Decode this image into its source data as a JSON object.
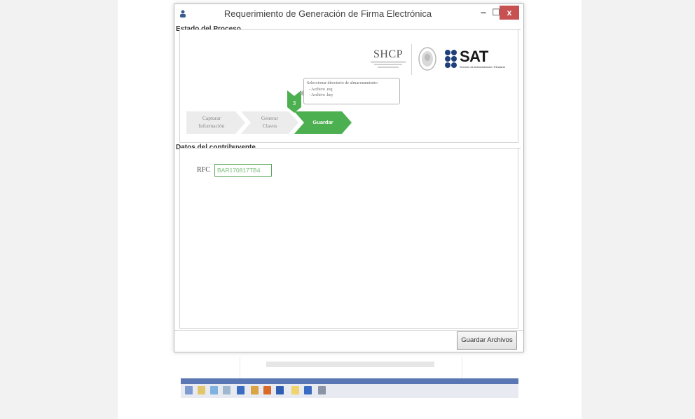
{
  "window": {
    "title": "Requerimiento de Generación de Firma Electrónica",
    "controls": {
      "minimize": "‒",
      "maximize": "☐",
      "close": "x"
    }
  },
  "estado": {
    "group_label": "Estado del Proceso",
    "logos": {
      "shcp": "SHCP",
      "sat": "SAT",
      "sat_subtitle": "Servicio de Administración Tributaria"
    },
    "callout": {
      "title": "Seleccionar directorio de almacenamiento",
      "items": [
        "- Archivo .req",
        "- Archivo .key"
      ]
    },
    "steps": [
      {
        "line1": "Capturar",
        "line2": "Información",
        "active": false
      },
      {
        "line1": "Generar",
        "line2": "Claves",
        "active": false
      },
      {
        "line1": "Guardar",
        "line2": "",
        "active": true
      }
    ]
  },
  "contribuyente": {
    "group_label": "Datos del contribuyente",
    "rfc_label": "RFC",
    "rfc_value": "BAR170817TB4"
  },
  "actions": {
    "save_label": "Guardar Archivos"
  },
  "colors": {
    "step_active": "#4caf50",
    "step_inactive": "#ececec",
    "close_button": "#c75050",
    "taskbar_blue": "#5b77b3"
  }
}
